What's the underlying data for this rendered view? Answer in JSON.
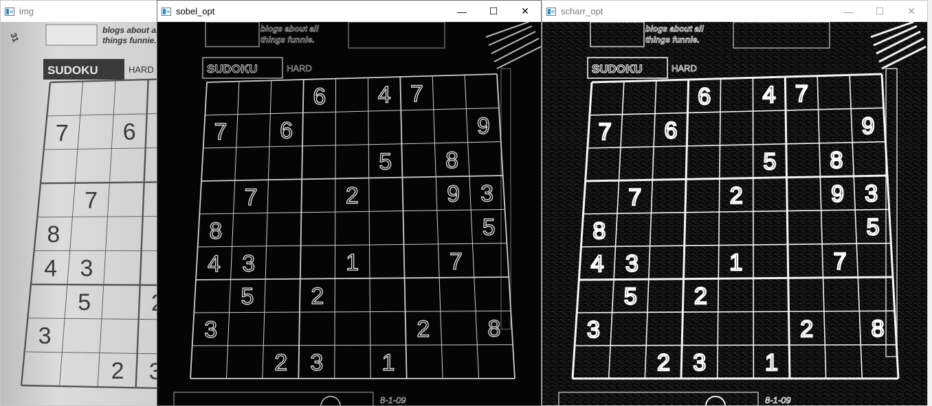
{
  "windows": [
    {
      "title": "img"
    },
    {
      "title": "sobel_opt"
    },
    {
      "title": "scharr_opt"
    }
  ],
  "controls": {
    "minimize": "—",
    "maximize": "☐",
    "close": "✕"
  },
  "sudoku": {
    "header": "SUDOKU",
    "difficulty": "HARD",
    "blog_text": [
      "blogs about all",
      "things funnie."
    ],
    "date": "8-1-09",
    "corner_number": "31",
    "clues": [
      [
        null,
        null,
        null,
        "6",
        null,
        "4",
        "7",
        null,
        null
      ],
      [
        "7",
        null,
        "6",
        null,
        null,
        null,
        null,
        null,
        "9"
      ],
      [
        null,
        null,
        null,
        null,
        null,
        "5",
        null,
        "8",
        null
      ],
      [
        null,
        "7",
        null,
        null,
        "2",
        null,
        null,
        "9",
        "3"
      ],
      [
        "8",
        null,
        null,
        null,
        null,
        null,
        null,
        null,
        "5"
      ],
      [
        "4",
        "3",
        null,
        null,
        "1",
        null,
        null,
        "7",
        null
      ],
      [
        null,
        "5",
        null,
        "2",
        null,
        null,
        null,
        null,
        null
      ],
      [
        "3",
        null,
        null,
        null,
        null,
        null,
        "2",
        null,
        "8"
      ],
      [
        null,
        null,
        "2",
        "3",
        null,
        "1",
        null,
        null,
        null
      ]
    ]
  }
}
